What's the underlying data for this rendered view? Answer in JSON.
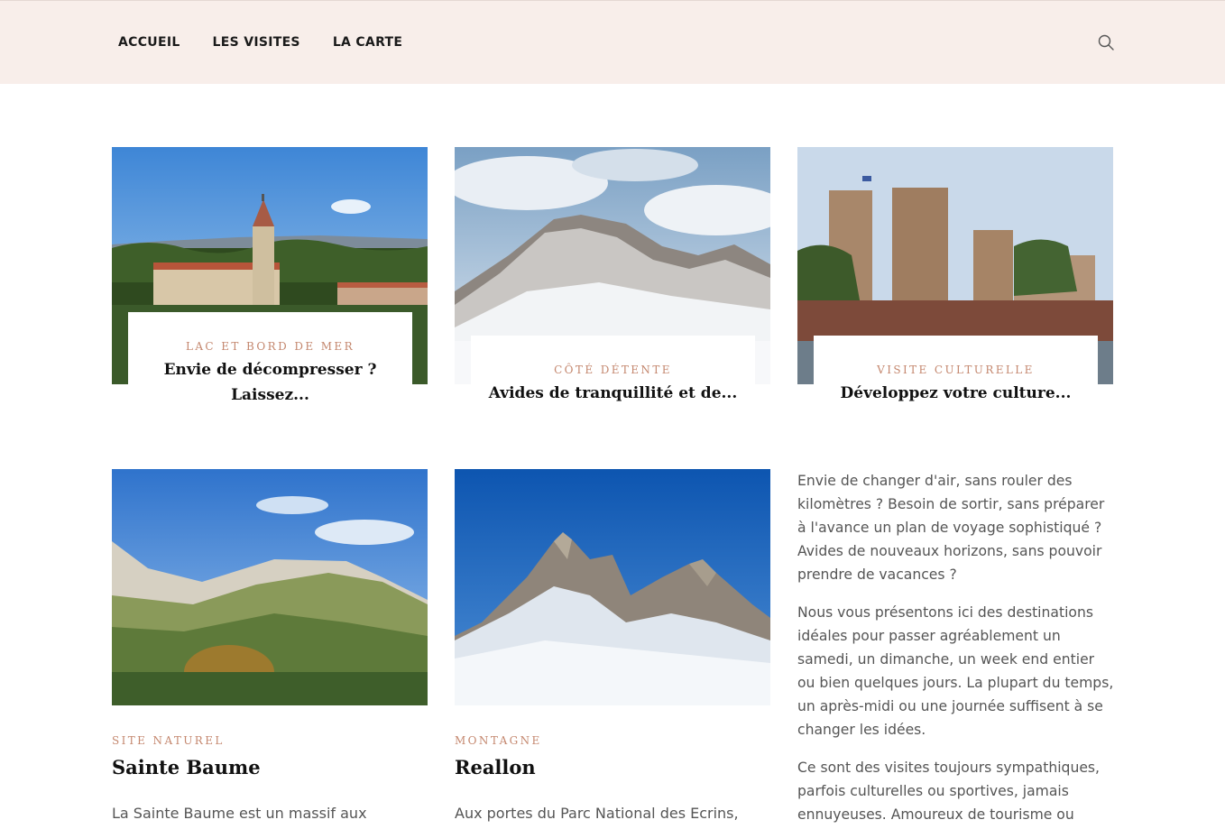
{
  "nav": {
    "items": [
      "ACCUEIL",
      "LES VISITES",
      "LA CARTE"
    ]
  },
  "icons": {
    "search": "search-icon"
  },
  "colors": {
    "header_bg": "#f8eeea",
    "category": "#c4876e",
    "title": "#111111",
    "text": "#555555"
  },
  "featured": [
    {
      "category": "LAC ET BORD DE MER",
      "title_line1": "Envie de décompresser ?",
      "title_line2": "Laissez..."
    },
    {
      "category": "CÔTÉ DÉTENTE",
      "title_line1": "Avides de tranquillité et de...",
      "title_line2": ""
    },
    {
      "category": "VISITE CULTURELLE",
      "title_line1": "Développez votre culture...",
      "title_line2": ""
    }
  ],
  "posts": [
    {
      "category": "SITE NATUREL",
      "title": "Sainte Baume",
      "excerpt": "La Sainte Baume est un massif aux multiples"
    },
    {
      "category": "MONTAGNE",
      "title": "Reallon",
      "excerpt": "Aux portes du Parc National des Ecrins,"
    }
  ],
  "intro": {
    "p1": "Envie de changer d'air, sans rouler des kilomètres ? Besoin de sortir, sans préparer à l'avance un plan de voyage sophistiqué ? Avides de nouveaux horizons, sans pouvoir prendre de vacances ?",
    "p2": "Nous vous présentons ici des destinations idéales pour passer agréablement un samedi, un dimanche, un week end entier ou bien quelques jours. La plupart du temps, un après-midi ou une journée suffisent à se changer les idées.",
    "p3": "Ce sont des visites toujours sympathiques, parfois culturelles ou sportives, jamais ennuyeuses. Amoureux de tourisme ou simple"
  }
}
